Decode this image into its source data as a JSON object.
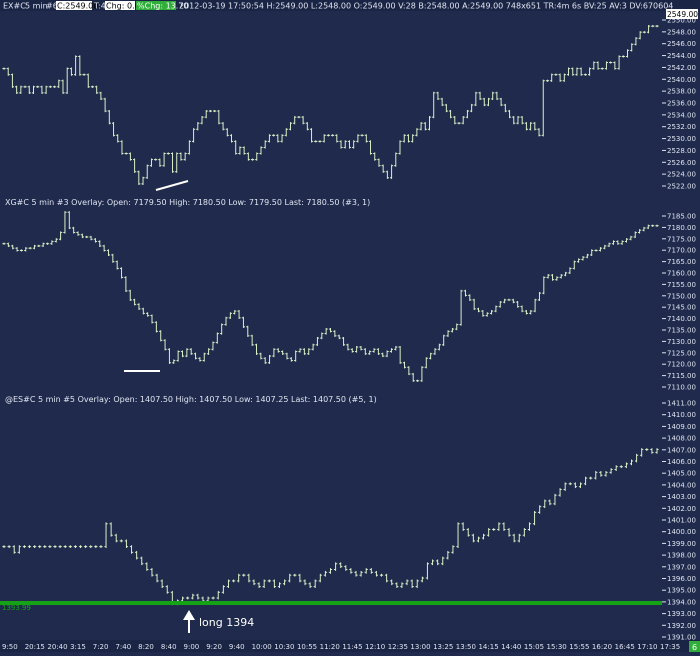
{
  "header": {
    "symbol": "EX#C",
    "interval": "5 min",
    "study": "#6",
    "last_box": "C:2549.00",
    "trades": "T:4",
    "chg_box": "Chg: 0.00",
    "pct_chg_box": "%Chg: 13.70",
    "info": "2012-03-19 17:50:54 H:2549.00 L:2548.00 O:2549.00 V:28 B:2548.00 A:2549.00 748x651 TR:4m 6s BV:25 AV:3 DV:670604"
  },
  "colors": {
    "background": "#1f2a4c",
    "bar": "#d8f0c8",
    "axis_text": "#dfe4f0",
    "header_green": "#2fae3a",
    "overlay_text": "#9bd78f",
    "support_line": "#15a215",
    "annotation": "#ffffff"
  },
  "panels": [
    {
      "title": "",
      "last_label": "2549.00",
      "y_ticks": [
        "2550.00",
        "2548.00",
        "2546.00",
        "2544.00",
        "2542.00",
        "2540.00",
        "2538.00",
        "2536.00",
        "2534.00",
        "2532.00",
        "2530.00",
        "2528.00",
        "2526.00",
        "2524.00",
        "2522.00"
      ]
    },
    {
      "title": "XG#C  5 min   #3 Overlay:  Open: 7179.50  High: 7180.50  Low: 7179.50  Last: 7180.50   (#3, 1)",
      "y_ticks": [
        "7185.00",
        "7180.00",
        "7175.00",
        "7170.00",
        "7165.00",
        "7160.00",
        "7155.00",
        "7150.00",
        "7145.00",
        "7140.00",
        "7135.00",
        "7130.00",
        "7125.00",
        "7120.00",
        "7115.00",
        "7110.00"
      ]
    },
    {
      "title": "@ES#C  5 min   #5 Overlay:  Open: 1407.50  High: 1407.50  Low: 1407.25  Last: 1407.50   (#5, 1)",
      "support_label": "1393.99",
      "annotation": "long 1394",
      "y_ticks": [
        "1411.00",
        "1410.00",
        "1409.00",
        "1408.00",
        "1407.00",
        "1406.00",
        "1405.00",
        "1404.00",
        "1403.00",
        "1402.00",
        "1401.00",
        "1400.00",
        "1399.00",
        "1398.00",
        "1397.00",
        "1396.00",
        "1395.00",
        "1394.00",
        "1393.00",
        "1392.00",
        "1391.00"
      ]
    }
  ],
  "x_axis": {
    "labels": [
      "9:50",
      "20:15",
      "20:40",
      "3:15",
      "7:20",
      "7:40",
      "8:20",
      "8:40",
      "9:00",
      "9:20",
      "9:40",
      "10:00",
      "10:30",
      "10:55",
      "11:20",
      "11:45",
      "12:10",
      "12:35",
      "13:00",
      "13:25",
      "13:50",
      "14:15",
      "14:40",
      "15:05",
      "15:30",
      "15:55",
      "16:20",
      "16:45",
      "17:10",
      "17:35"
    ],
    "right_tag": "6"
  },
  "chart_data": {
    "type": "line",
    "note_style": "OHLC bar charts, 5-minute bars, three stacked panels",
    "series": [
      {
        "name": "EX#C",
        "ylim": [
          2521,
          2551
        ],
        "points": [
          2542,
          2541,
          2539,
          2538,
          2539,
          2539,
          2538,
          2539,
          2539,
          2538,
          2539,
          2539,
          2539,
          2540,
          2538,
          2542,
          2541,
          2544,
          2541,
          2541,
          2539,
          2539,
          2538,
          2537,
          2535,
          2533,
          2531,
          2530,
          2528,
          2528,
          2527,
          2525,
          2523,
          2524,
          2526,
          2527,
          2527,
          2526,
          2528,
          2528,
          2525,
          2528,
          2527,
          2528,
          2530,
          2532,
          2533,
          2534,
          2535,
          2535,
          2535,
          2533,
          2532,
          2531,
          2530,
          2528,
          2529,
          2528,
          2527,
          2527,
          2528,
          2529,
          2530,
          2531,
          2531,
          2530,
          2531,
          2532,
          2533,
          2534,
          2534,
          2533,
          2532,
          2530,
          2530,
          2530,
          2531,
          2531,
          2531,
          2530,
          2529,
          2530,
          2529,
          2530,
          2531,
          2531,
          2530,
          2528,
          2527,
          2526,
          2525,
          2524,
          2526,
          2528,
          2530,
          2531,
          2530,
          2531,
          2532,
          2533,
          2532,
          2534,
          2538,
          2537,
          2536,
          2535,
          2534,
          2533,
          2533,
          2534,
          2535,
          2536,
          2538,
          2537,
          2536,
          2537,
          2538,
          2537,
          2536,
          2535,
          2534,
          2533,
          2534,
          2533,
          2532,
          2533,
          2532,
          2531,
          2540,
          2540,
          2541,
          2541,
          2540,
          2541,
          2542,
          2541,
          2542,
          2541,
          2541,
          2542,
          2543,
          2542,
          2542,
          2543,
          2543,
          2542,
          2544,
          2544,
          2545,
          2546,
          2547,
          2548,
          2548,
          2549,
          2549,
          2549
        ]
      },
      {
        "name": "XG#C",
        "ylim": [
          7107,
          7188
        ],
        "points": [
          7173,
          7172,
          7171,
          7170,
          7170,
          7171,
          7171,
          7172,
          7172,
          7173,
          7173,
          7174,
          7175,
          7178,
          7187,
          7180,
          7178,
          7177,
          7176,
          7176,
          7175,
          7174,
          7172,
          7170,
          7168,
          7165,
          7162,
          7158,
          7152,
          7148,
          7146,
          7144,
          7142,
          7141,
          7138,
          7134,
          7130,
          7126,
          7120,
          7121,
          7125,
          7123,
          7126,
          7124,
          7122,
          7121,
          7124,
          7126,
          7129,
          7133,
          7137,
          7140,
          7142,
          7143,
          7140,
          7136,
          7132,
          7128,
          7124,
          7122,
          7120,
          7123,
          7126,
          7125,
          7124,
          7122,
          7121,
          7125,
          7126,
          7124,
          7126,
          7128,
          7131,
          7133,
          7135,
          7134,
          7132,
          7131,
          7128,
          7126,
          7125,
          7127,
          7126,
          7124,
          7125,
          7126,
          7124,
          7123,
          7125,
          7126,
          7127,
          7120,
          7118,
          7115,
          7112,
          7112,
          7118,
          7122,
          7124,
          7126,
          7128,
          7132,
          7134,
          7135,
          7137,
          7152,
          7150,
          7148,
          7144,
          7143,
          7141,
          7142,
          7143,
          7145,
          7147,
          7148,
          7148,
          7147,
          7145,
          7143,
          7142,
          7143,
          7148,
          7151,
          7158,
          7159,
          7157,
          7158,
          7159,
          7160,
          7162,
          7165,
          7166,
          7167,
          7168,
          7170,
          7170,
          7171,
          7172,
          7173,
          7174,
          7173,
          7174,
          7175,
          7176,
          7178,
          7179,
          7180,
          7181,
          7181,
          7181
        ]
      },
      {
        "name": "@ES#C",
        "ylim": [
          1391,
          1411.4
        ],
        "points": [
          1399,
          1399,
          1398.5,
          1399,
          1399,
          1399,
          1399,
          1399,
          1399,
          1399,
          1399,
          1399,
          1399,
          1399,
          1399,
          1399,
          1399,
          1399,
          1399,
          1399,
          1401,
          1400,
          1399.5,
          1399.5,
          1399,
          1398.5,
          1398,
          1397.5,
          1397,
          1396.5,
          1396,
          1395.5,
          1395,
          1394,
          1394.25,
          1394.5,
          1394.5,
          1394.75,
          1394.5,
          1394.25,
          1394.5,
          1394.5,
          1395,
          1395.5,
          1396,
          1396,
          1396.5,
          1396.5,
          1396,
          1395.75,
          1395.5,
          1396,
          1396,
          1395.5,
          1395.75,
          1396,
          1396.5,
          1396.5,
          1396,
          1395.75,
          1395.5,
          1396,
          1396.5,
          1396.75,
          1397,
          1397.5,
          1397.25,
          1397,
          1396.75,
          1396.5,
          1396.75,
          1397,
          1396.75,
          1396.5,
          1396.5,
          1396,
          1395.75,
          1395.5,
          1395.75,
          1396,
          1395.5,
          1396,
          1396.25,
          1397.5,
          1397.75,
          1397.5,
          1398,
          1398.5,
          1399,
          1401,
          1400.5,
          1400,
          1399.5,
          1399.75,
          1400,
          1400.5,
          1400.5,
          1401,
          1400.5,
          1400,
          1399.5,
          1400,
          1400.5,
          1401,
          1402,
          1402.5,
          1403,
          1402.75,
          1403.5,
          1404,
          1404.5,
          1404.5,
          1404.25,
          1404.5,
          1405,
          1405,
          1405.5,
          1405.25,
          1405.5,
          1405.75,
          1406,
          1406,
          1406.25,
          1406.5,
          1407,
          1407.5,
          1407.5,
          1407.25,
          1407.5
        ]
      }
    ],
    "x_labels": [
      "9:50",
      "20:15",
      "20:40",
      "3:15",
      "7:20",
      "7:40",
      "8:20",
      "8:40",
      "9:00",
      "9:20",
      "9:40",
      "10:00",
      "10:30",
      "10:55",
      "11:20",
      "11:45",
      "12:10",
      "12:35",
      "13:00",
      "13:25",
      "13:50",
      "14:15",
      "14:40",
      "15:05",
      "15:30",
      "15:55",
      "16:20",
      "16:45",
      "17:10",
      "17:35"
    ],
    "support_level": 1393.99,
    "annotation": "long 1394"
  }
}
